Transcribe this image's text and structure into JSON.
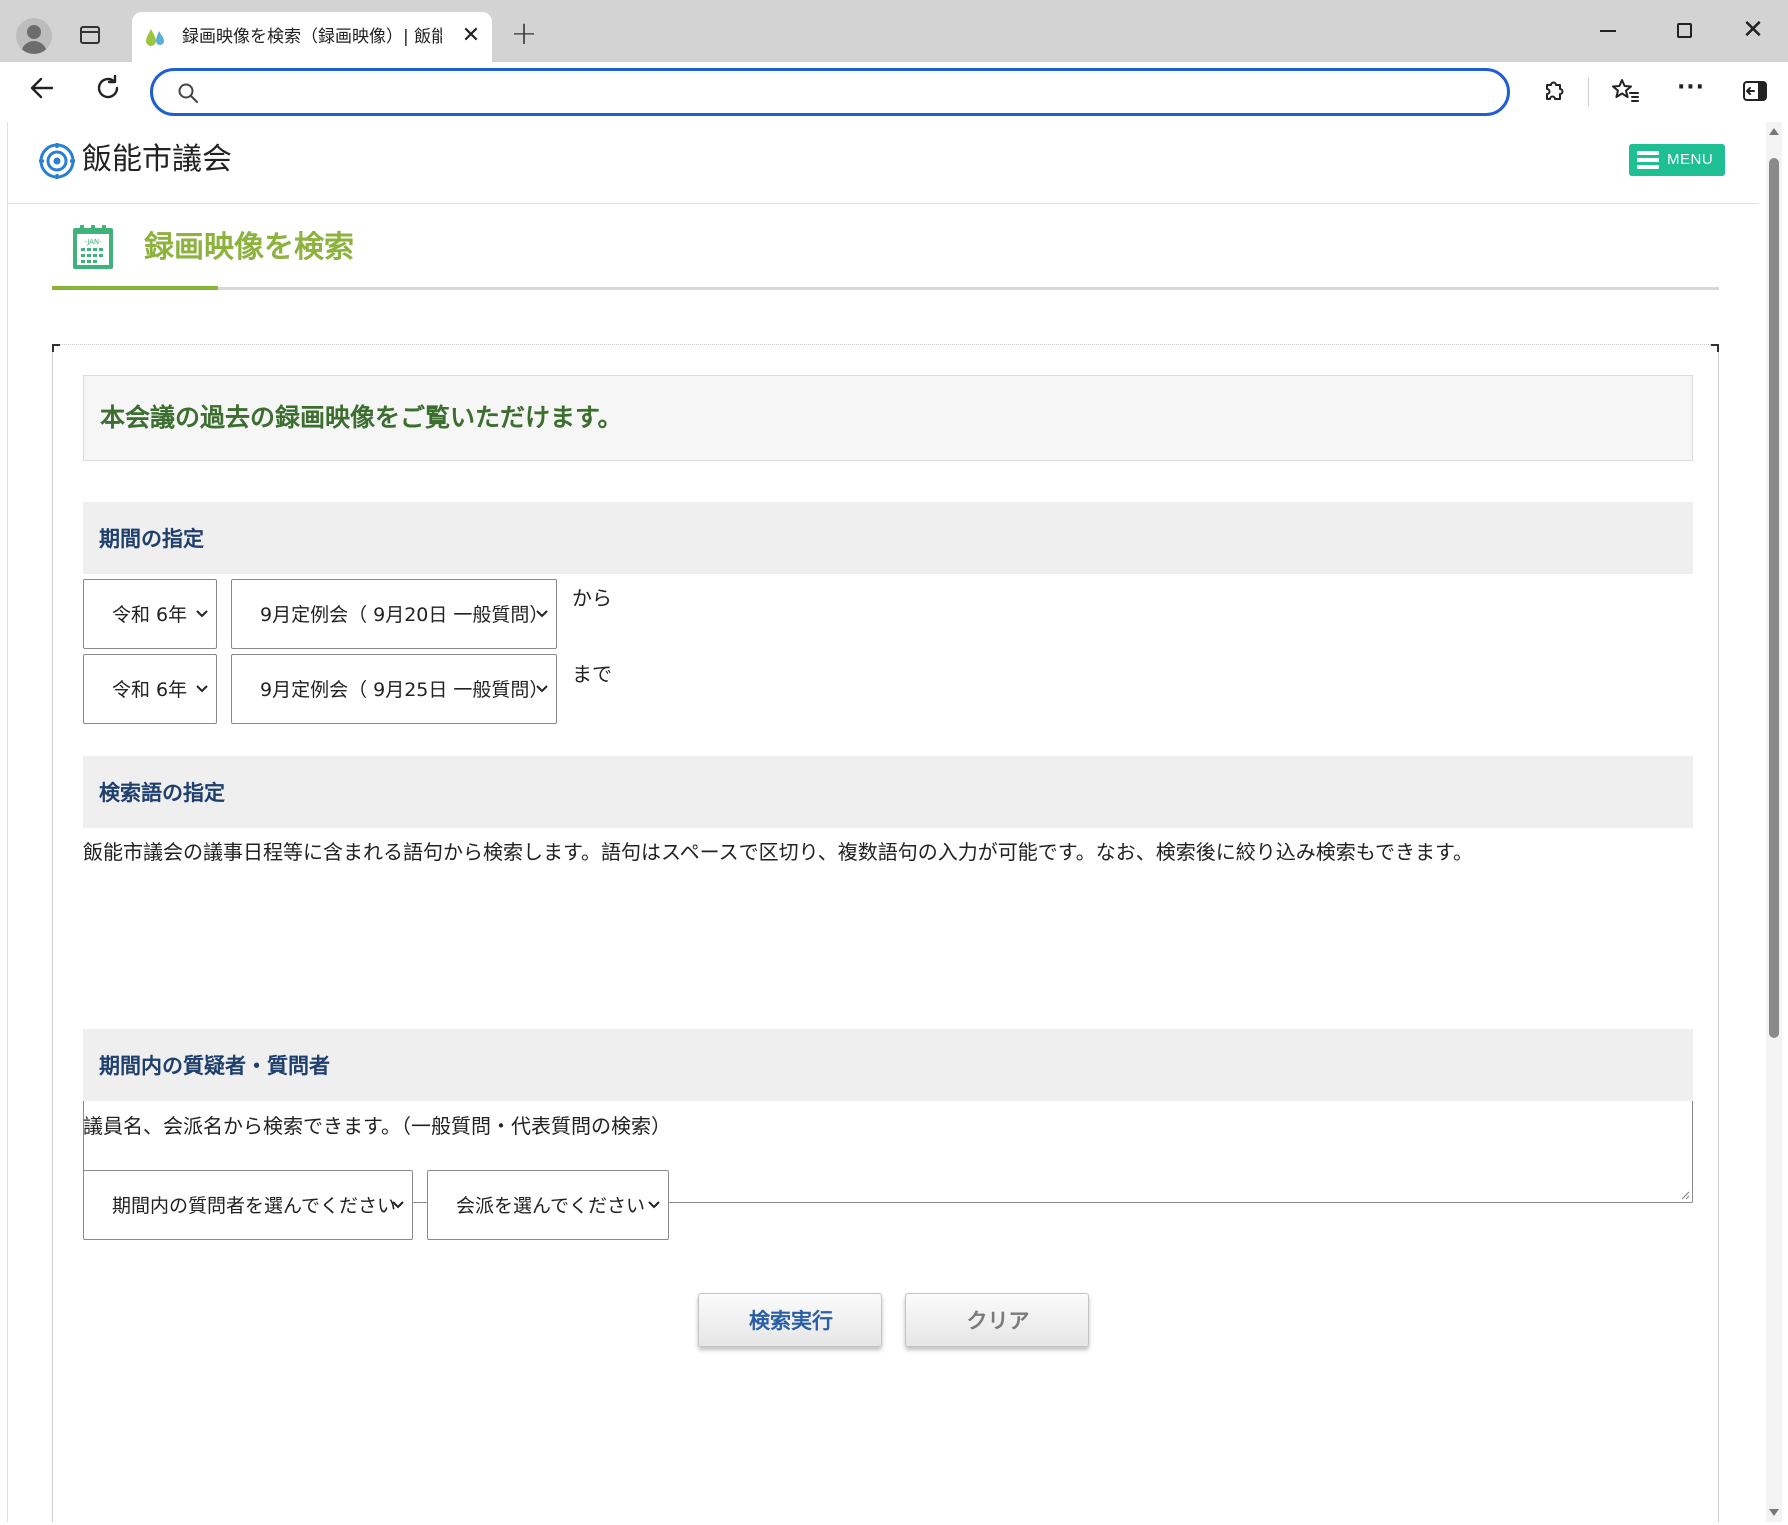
{
  "browser": {
    "tab_title": "録画映像を検索（録画映像）| 飯能市議会",
    "tab_close": "✕",
    "new_tab": "+",
    "window_close": "✕",
    "address_value": "",
    "address_placeholder": "",
    "more_label": "···"
  },
  "site": {
    "name": "飯能市議会",
    "menu_label": "MENU",
    "accent_color": "#1fbf94"
  },
  "page": {
    "title": "録画映像を検索",
    "title_icon_text": "-JAN-",
    "title_color": "#8db23e",
    "intro": "本会議の過去の録画映像をご覧いただけます。"
  },
  "period": {
    "heading": "期間の指定",
    "from": {
      "year": "令和 6年",
      "session": "9月定例会（ 9月20日 一般質問）",
      "suffix": "から"
    },
    "to": {
      "year": "令和 6年",
      "session": "9月定例会（ 9月25日 一般質問）",
      "suffix": "まで"
    }
  },
  "keyword": {
    "heading": "検索語の指定",
    "description": "飯能市議会の議事日程等に含まれる語句から検索します。語句はスペースで区切り、複数語句の入力が可能です。なお、検索後に絞り込み検索もできます。",
    "value": ""
  },
  "speaker": {
    "heading": "期間内の質疑者・質問者",
    "description": "議員名、会派名から検索できます。（一般質問・代表質問の検索）",
    "member_select": "期間内の質問者を選んでください",
    "faction_select": "会派を選んでください"
  },
  "actions": {
    "search": "検索実行",
    "clear": "クリア"
  }
}
